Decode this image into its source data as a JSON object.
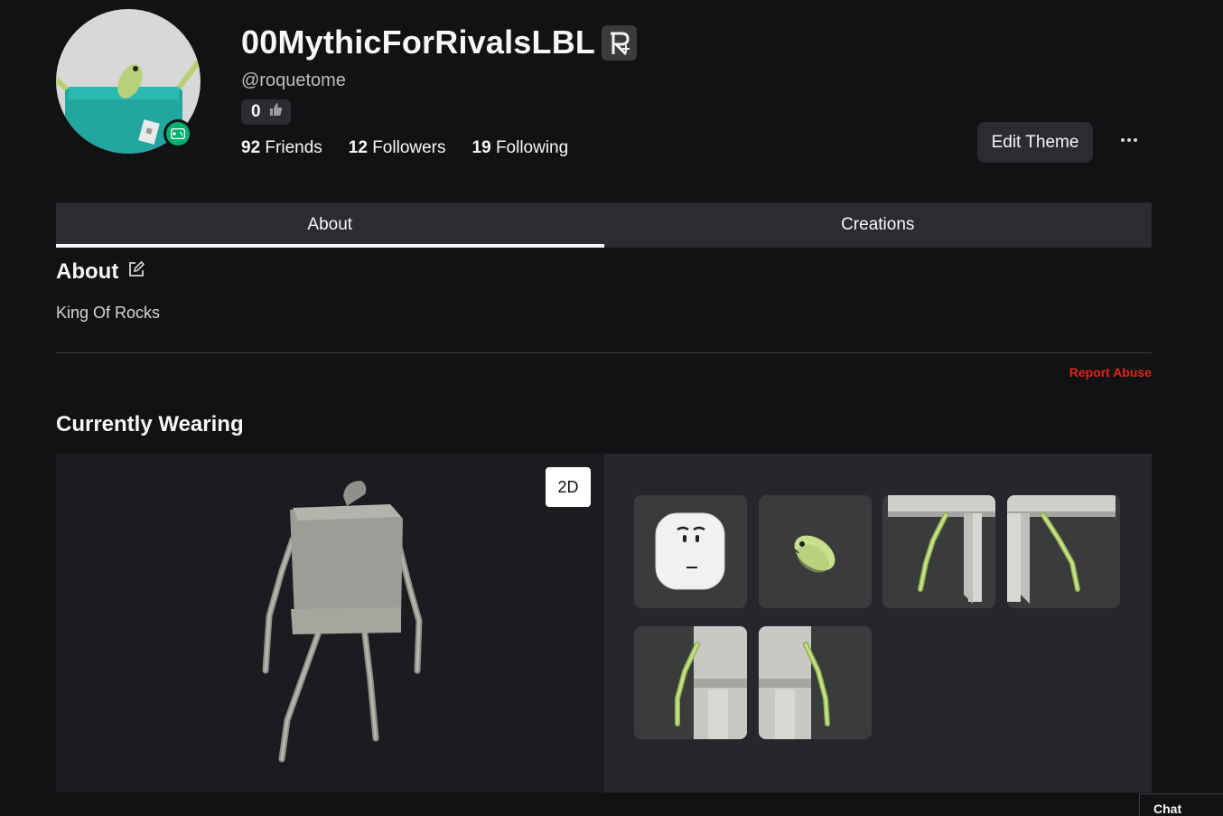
{
  "profile": {
    "display_name": "00MythicForRivalsLBL",
    "username": "@roquetome",
    "likes": "0",
    "stats": [
      {
        "value": "92",
        "label": "Friends"
      },
      {
        "value": "12",
        "label": "Followers"
      },
      {
        "value": "19",
        "label": "Following"
      }
    ],
    "premium_icon": "premium-badge-icon",
    "presence_icon": "gamepad-icon"
  },
  "actions": {
    "edit_theme": "Edit Theme",
    "more_icon": "ellipsis-icon"
  },
  "tabs": [
    {
      "label": "About",
      "active": true
    },
    {
      "label": "Creations",
      "active": false
    }
  ],
  "about": {
    "title": "About",
    "description": "King Of Rocks",
    "report": "Report Abuse"
  },
  "wearing": {
    "title": "Currently Wearing",
    "toggle_label": "2D",
    "items": [
      {
        "name": "face-item"
      },
      {
        "name": "bean-head-accessory"
      },
      {
        "name": "torso-item"
      },
      {
        "name": "torso-item"
      },
      {
        "name": "leg-item"
      },
      {
        "name": "leg-item"
      }
    ]
  },
  "chat": {
    "label": "Chat"
  },
  "colors": {
    "background": "#111214",
    "surface": "#2a2c31",
    "presence": "#00b06f",
    "report": "#e2231a",
    "accessory_green": "#c6e08c"
  }
}
